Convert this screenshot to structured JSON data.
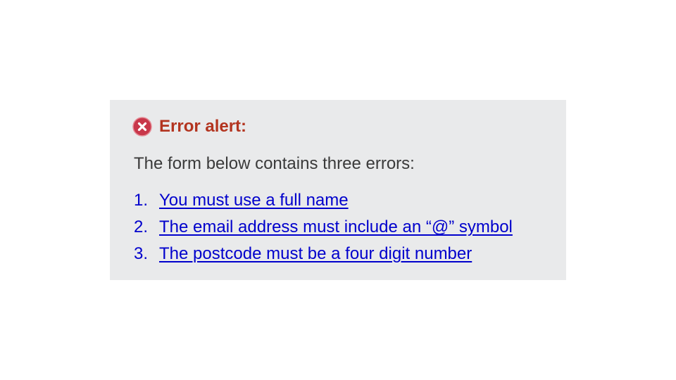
{
  "alert": {
    "icon": "error-x-circle-icon",
    "title": "Error alert:",
    "description": "The form below contains three errors:",
    "errors": [
      {
        "number": "1.",
        "text": "You must use a full name"
      },
      {
        "number": "2.",
        "text": "The email address must include an “@” symbol"
      },
      {
        "number": "3.",
        "text": "The postcode must be a four digit number"
      }
    ]
  },
  "colors": {
    "alert_background": "#e9eaeb",
    "error_red": "#b3341f",
    "link_blue": "#0000cc",
    "text_gray": "#3a3a3a"
  }
}
